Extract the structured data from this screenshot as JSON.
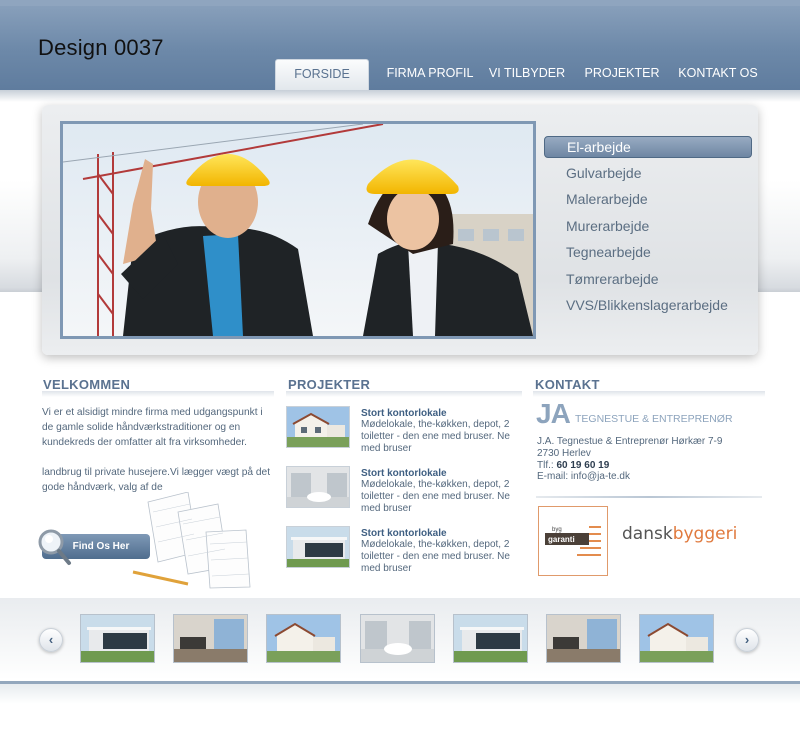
{
  "site": {
    "title": "Design 0037"
  },
  "nav": [
    {
      "label": "FORSIDE",
      "active": true
    },
    {
      "label": "FIRMA PROFIL"
    },
    {
      "label": "VI TILBYDER"
    },
    {
      "label": "PROJEKTER"
    },
    {
      "label": "KONTAKT OS"
    }
  ],
  "services": [
    {
      "label": "El-arbejde",
      "active": true
    },
    {
      "label": "Gulvarbejde"
    },
    {
      "label": "Malerarbejde"
    },
    {
      "label": "Murerarbejde"
    },
    {
      "label": "Tegnearbejde"
    },
    {
      "label": "Tømrerarbejde"
    },
    {
      "label": "VVS/Blikkenslagerarbejde"
    }
  ],
  "welcome": {
    "title": "VELKOMMEN",
    "para1": "Vi er et alsidigt mindre firma med udgangspunkt  i de gamle solide håndværkstraditioner og en kundekreds der omfatter alt fra virksomheder.",
    "para2": "landbrug til private husejere.Vi lægger vægt på det gode håndværk, valg af de",
    "button": "Find Os Her"
  },
  "projects": {
    "title": "PROJEKTER",
    "items": [
      {
        "title": "Stort kontorlokale",
        "desc": "Mødelokale, the-køkken, depot, 2 toiletter - den ene med bruser. Ne med bruser"
      },
      {
        "title": "Stort kontorlokale",
        "desc": "Mødelokale, the-køkken, depot, 2 toiletter - den ene med bruser. Ne med bruser"
      },
      {
        "title": "Stort kontorlokale",
        "desc": "Mødelokale, the-køkken, depot, 2 toiletter - den ene med bruser. Ne med bruser"
      }
    ]
  },
  "contact": {
    "title": "KONTAKT",
    "logo_big": "JA",
    "logo_sub": "TEGNESTUE & ENTREPRENØR",
    "line1": "J.A. Tegnestue & Entreprenør  Hørkær 7-9",
    "line2": "2730 Herlev",
    "tlf_label": "Tlf.: ",
    "tlf": "60 19 60 19",
    "email": "E-mail: info@ja-te.dk",
    "logo1_top": "byg",
    "logo1_main": "garanti",
    "logo2_a": "dansk",
    "logo2_b": "byggeri"
  },
  "carousel": {
    "prev": "‹",
    "next": "›",
    "items": [
      "house",
      "interior",
      "house-white",
      "bathroom",
      "house",
      "interior",
      "house-white"
    ]
  },
  "colors": {
    "header": "#6d89a9",
    "accent": "#5a7290",
    "orange": "#e07a3e"
  }
}
